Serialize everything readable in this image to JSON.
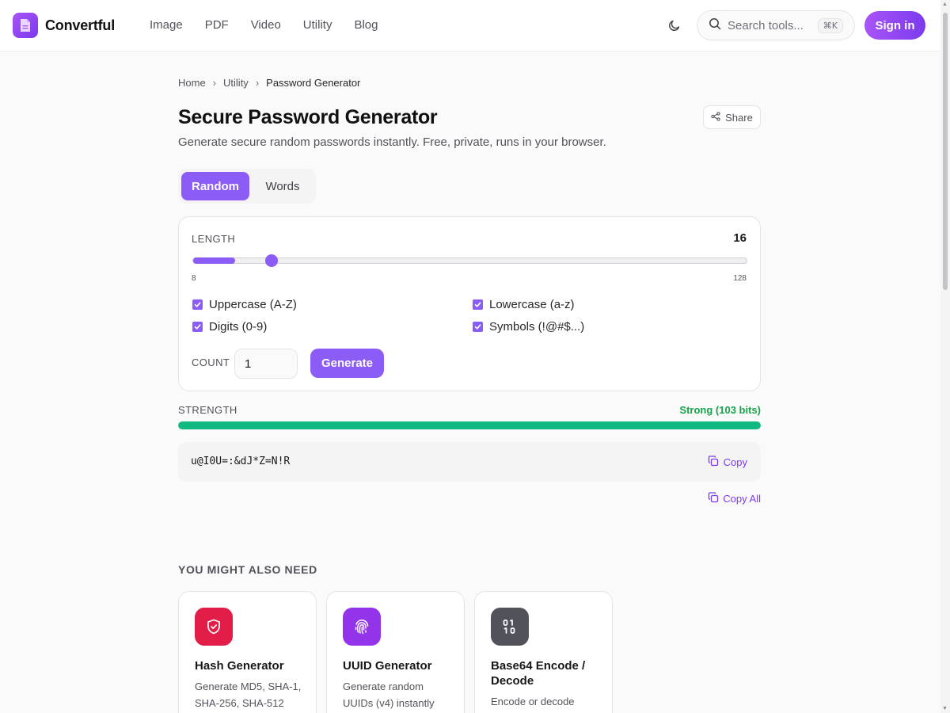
{
  "header": {
    "brand": "Convertful",
    "nav": [
      "Image",
      "PDF",
      "Video",
      "Utility",
      "Blog"
    ],
    "search_placeholder": "Search tools...",
    "search_shortcut": "⌘K",
    "signin_label": "Sign in"
  },
  "breadcrumb": [
    "Home",
    "Utility",
    "Password Generator"
  ],
  "page": {
    "title": "Secure Password Generator",
    "subtitle": "Generate secure random passwords instantly. Free, private, runs in your browser.",
    "share_label": "Share"
  },
  "tabs": [
    {
      "label": "Random",
      "active": true
    },
    {
      "label": "Words",
      "active": false
    }
  ],
  "settings": {
    "length_label": "LENGTH",
    "length_value": 16,
    "length_min": 8,
    "length_max": 128,
    "options": [
      {
        "label": "Uppercase (A-Z)",
        "checked": true
      },
      {
        "label": "Lowercase (a-z)",
        "checked": true
      },
      {
        "label": "Digits (0-9)",
        "checked": true
      },
      {
        "label": "Symbols (!@#$...)",
        "checked": true
      }
    ],
    "count_label": "COUNT",
    "count_value": "1",
    "generate_label": "Generate"
  },
  "strength": {
    "label": "STRENGTH",
    "value_text": "Strong (103 bits)",
    "level": 1.0,
    "color": "#10b981"
  },
  "result": {
    "password": "u@I0U=:&dJ*Z=N!R",
    "copy_label": "Copy",
    "copy_all_label": "Copy All"
  },
  "related": {
    "title": "YOU MIGHT ALSO NEED",
    "items": [
      {
        "name": "Hash Generator",
        "desc": "Generate MD5, SHA-1, SHA-256, SHA-512",
        "icon": "shield-check-icon",
        "color": "#e11d48"
      },
      {
        "name": "UUID Generator",
        "desc": "Generate random UUIDs (v4) instantly",
        "icon": "fingerprint-icon",
        "color": "#9333ea"
      },
      {
        "name": "Base64 Encode / Decode",
        "desc": "Encode or decode",
        "icon": "binary-icon",
        "color": "#52525b"
      }
    ]
  },
  "colors": {
    "accent": "#8b5cf6",
    "success": "#10b981"
  }
}
